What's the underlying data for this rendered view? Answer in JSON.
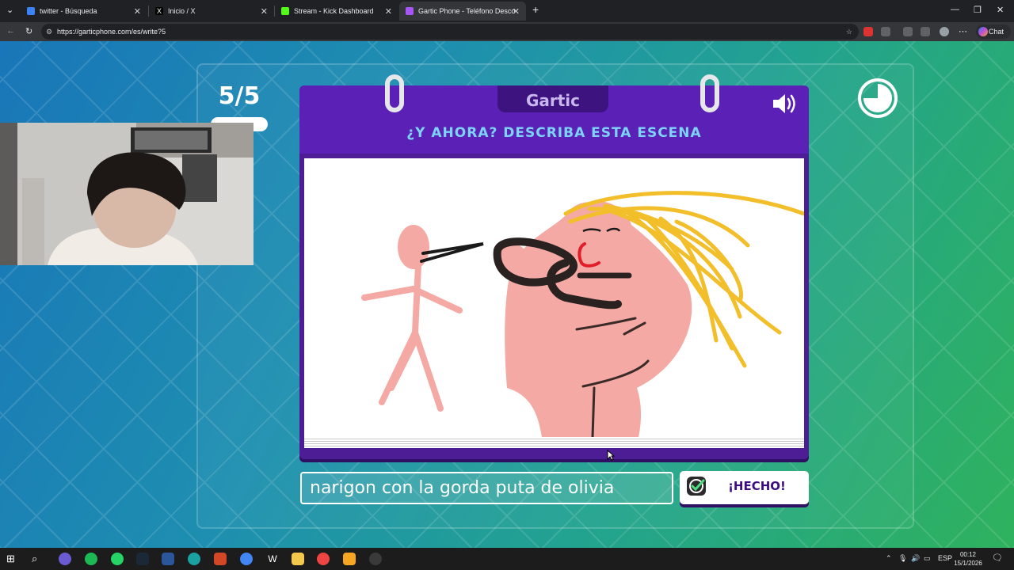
{
  "browser": {
    "tabs": [
      {
        "title": "twitter - Búsqueda",
        "active": false
      },
      {
        "title": "Inicio / X",
        "active": false
      },
      {
        "title": "Stream - Kick Dashboard",
        "active": false
      },
      {
        "title": "Gartic Phone - Teléfono Descomp",
        "active": true
      }
    ],
    "url": "https://garticphone.com/es/write?5",
    "chat_label": "Chat"
  },
  "game": {
    "round": "5/5",
    "logo": "Gartic",
    "prompt": "¿Y AHORA? DESCRIBA ESTA ESCENA",
    "answer_value": "narigon con la gorda puta de olivia",
    "done_label": "¡HECHO!"
  },
  "taskbar": {
    "lang": "ESP",
    "time": "00:12",
    "date": "15/1/2026"
  },
  "colors": {
    "card": "#4c1d95",
    "prompt": "#7dd3fc",
    "done_text": "#3b0f82"
  }
}
